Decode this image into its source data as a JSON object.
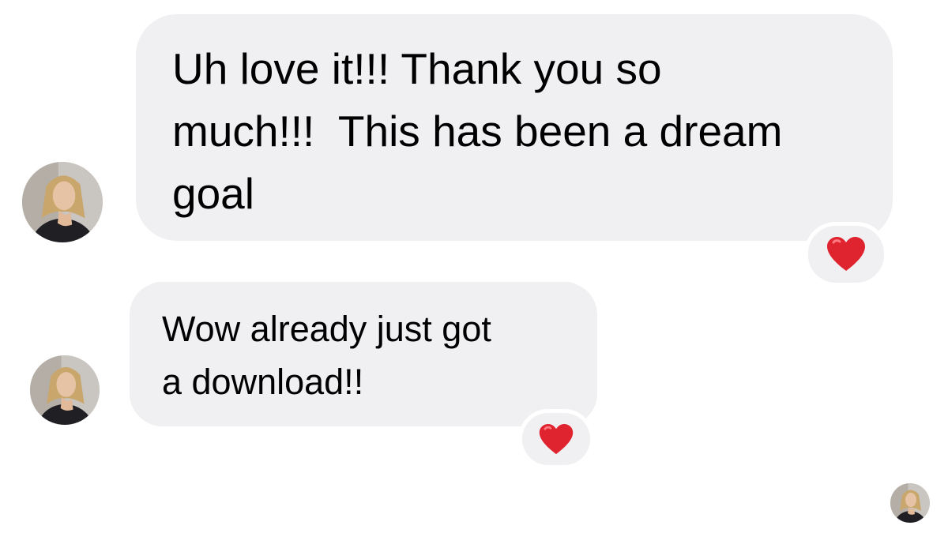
{
  "conversation": {
    "messages": [
      {
        "text": "Uh love it!!! Thank you so\nmuch!!!  This has been a dream\ngoal",
        "reaction": "red-heart"
      },
      {
        "text": "Wow already just got\na download!!",
        "reaction": "red-heart"
      }
    ]
  },
  "colors": {
    "bubble_background": "#f0f0f3",
    "page_background": "#ffffff",
    "heart": "#e0242f",
    "text": "#000000"
  },
  "icons": {
    "avatar": "profile-photo-avatar",
    "reaction": "heart-icon"
  }
}
